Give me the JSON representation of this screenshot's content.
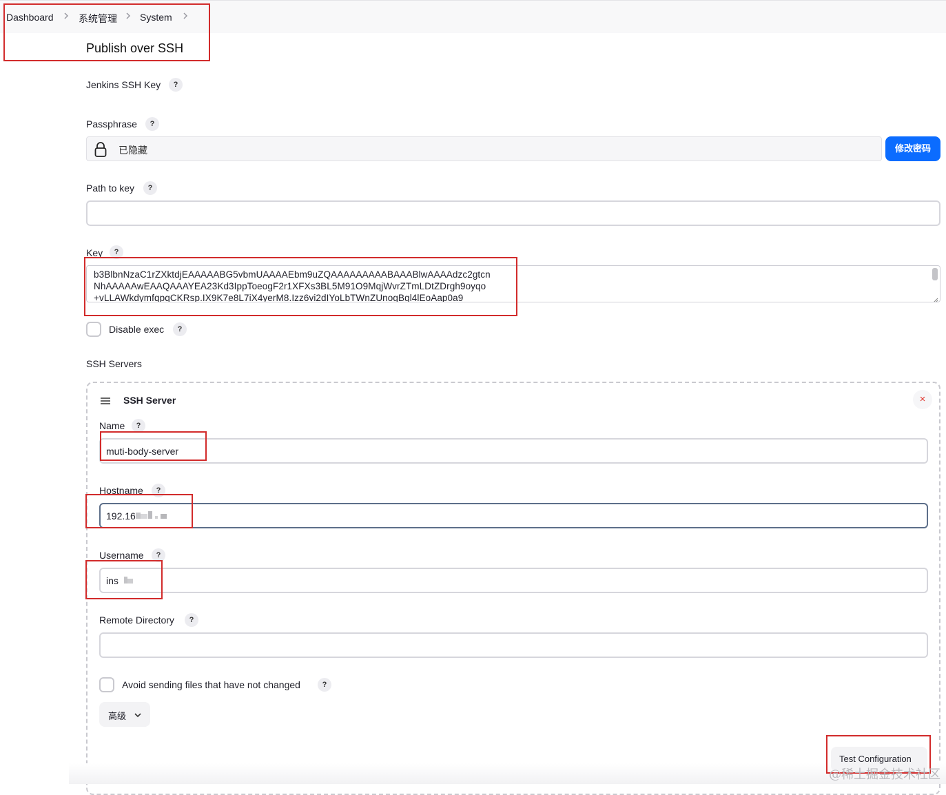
{
  "breadcrumb": {
    "items": [
      "Dashboard",
      "系统管理",
      "System"
    ]
  },
  "page": {
    "title": "Publish over SSH"
  },
  "jenkins_ssh_key": {
    "label": "Jenkins SSH Key",
    "help": "?"
  },
  "passphrase": {
    "label": "Passphrase",
    "help": "?",
    "value": "已隐藏",
    "change_button": "修改密码"
  },
  "path_to_key": {
    "label": "Path to key",
    "help": "?",
    "value": ""
  },
  "key": {
    "label": "Key",
    "help": "?",
    "lines": [
      "b3BlbnNzaC1rZXktdjEAAAAABG5vbmUAAAAEbm9uZQAAAAAAAAABAAABlwAAAAdzc2gtcn",
      "NhAAAAAwEAAQAAAYEA23Kd3IppToeogF2r1XFXs3BL5M91O9MqjWvrZTmLDtZDrgh9oyqo",
      "+vLLAWkdymfqpqCKRsp.IX9K7e8L7iX4yerM8.Izz6vi2dIYoLbTWnZUnogBgl4lEoAap0a9"
    ]
  },
  "disable_exec": {
    "label": "Disable exec",
    "help": "?",
    "checked": false
  },
  "ssh_servers": {
    "label": "SSH Servers",
    "server": {
      "header": "SSH Server",
      "close": "×",
      "name": {
        "label": "Name",
        "help": "?",
        "value": "muti-body-server"
      },
      "hostname": {
        "label": "Hostname",
        "help": "?",
        "value": "192.16"
      },
      "username": {
        "label": "Username",
        "help": "?",
        "value": "ins"
      },
      "remote_directory": {
        "label": "Remote Directory",
        "help": "?",
        "value": ""
      },
      "avoid_sending": {
        "label": "Avoid sending files that have not changed",
        "help": "?",
        "checked": false
      },
      "advanced_button": "高级",
      "test_button": "Test Configuration"
    }
  },
  "watermark": "@稀土掘金技术社区",
  "colors": {
    "primary_button": "#0b6cff",
    "annotation_red": "#d22b2b",
    "close_red": "#e0362e"
  },
  "icons": [
    "chevron-right-icon",
    "lock-icon",
    "drag-handle-icon",
    "close-icon",
    "chevron-down-icon",
    "resize-grip-icon"
  ]
}
